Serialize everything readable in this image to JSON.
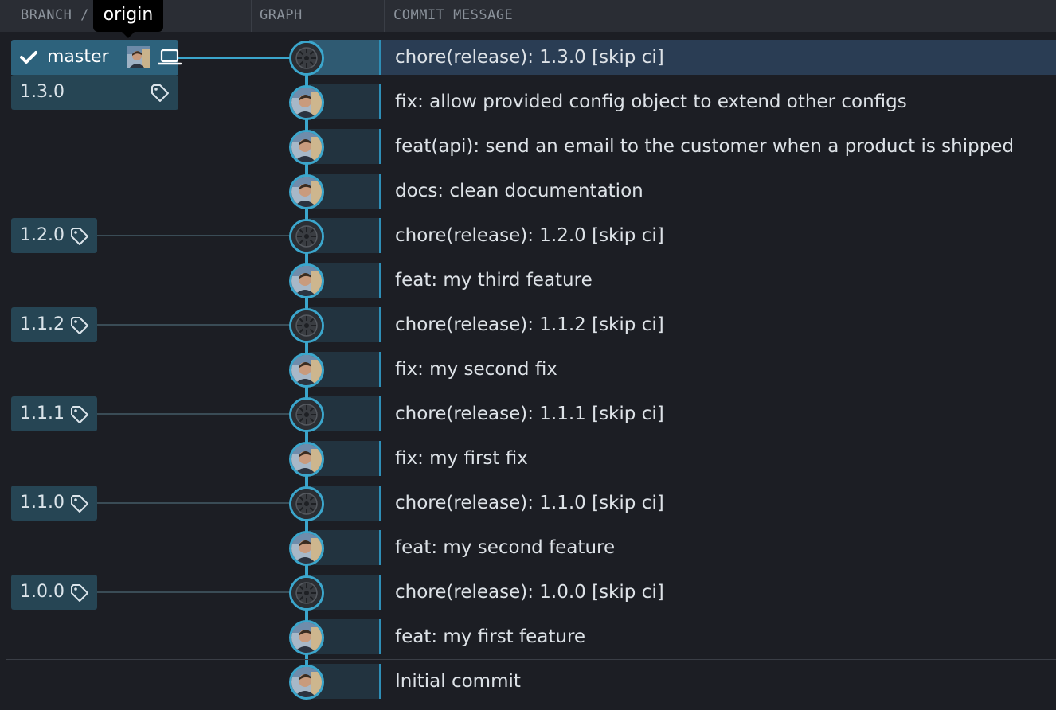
{
  "header": {
    "branch_col": "BRANCH / TAG",
    "graph_col": "GRAPH",
    "message_col": "COMMIT MESSAGE"
  },
  "tooltip": {
    "text": "origin"
  },
  "branch": {
    "name": "master",
    "checked": true
  },
  "tags": {
    "t130": "1.3.0",
    "t120": "1.2.0",
    "t112": "1.1.2",
    "t111": "1.1.1",
    "t110": "1.1.0",
    "t100": "1.0.0"
  },
  "commits": [
    {
      "message": "chore(release): 1.3.0 [skip ci]",
      "kind": "release"
    },
    {
      "message": "fix: allow provided config object to extend other configs",
      "kind": "user"
    },
    {
      "message": "feat(api): send an email to the customer when a product is shipped",
      "kind": "user"
    },
    {
      "message": "docs: clean documentation",
      "kind": "user"
    },
    {
      "message": "chore(release): 1.2.0 [skip ci]",
      "kind": "release"
    },
    {
      "message": "feat: my third feature",
      "kind": "user"
    },
    {
      "message": "chore(release): 1.1.2 [skip ci]",
      "kind": "release"
    },
    {
      "message": "fix: my second fix",
      "kind": "user"
    },
    {
      "message": "chore(release): 1.1.1 [skip ci]",
      "kind": "release"
    },
    {
      "message": "fix: my first fix",
      "kind": "user"
    },
    {
      "message": "chore(release): 1.1.0 [skip ci]",
      "kind": "release"
    },
    {
      "message": "feat: my second feature",
      "kind": "user"
    },
    {
      "message": "chore(release): 1.0.0 [skip ci]",
      "kind": "release"
    },
    {
      "message": "feat: my first feature",
      "kind": "user"
    },
    {
      "message": "Initial commit",
      "kind": "user"
    }
  ],
  "colors": {
    "accent": "#3ba6cc",
    "branch_bg": "#2d627c",
    "tag_bg": "#264554",
    "selected_row": "#2a3d54"
  },
  "icons": {
    "check": "check-icon",
    "laptop": "laptop-icon",
    "tag": "tag-icon",
    "bot_avatar": "bot-avatar-icon",
    "user_avatar": "user-avatar-icon"
  }
}
